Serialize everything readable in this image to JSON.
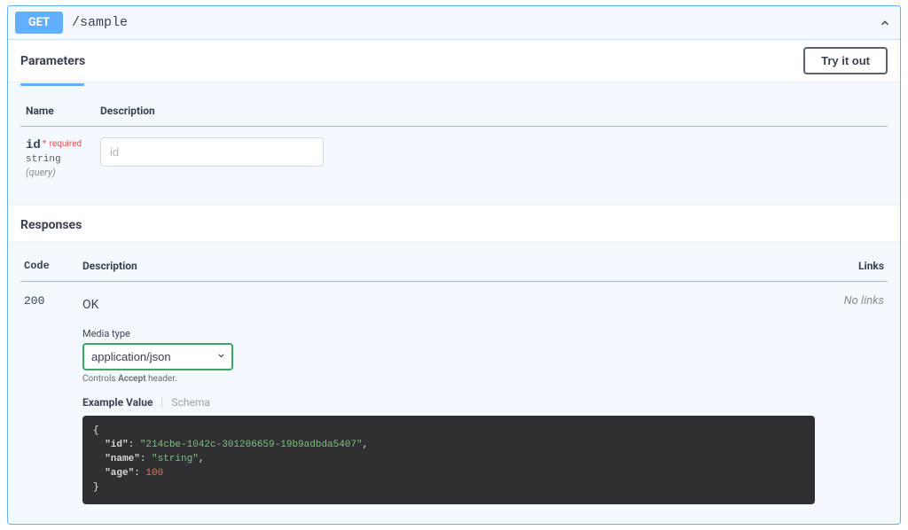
{
  "operation": {
    "method": "GET",
    "path": "/sample"
  },
  "sections": {
    "parameters_title": "Parameters",
    "try_it_out": "Try it out",
    "responses_title": "Responses"
  },
  "params_headers": {
    "name": "Name",
    "description": "Description"
  },
  "parameter": {
    "name": "id",
    "required_label": "required",
    "type": "string",
    "in_label": "(query)",
    "placeholder": "id"
  },
  "responses_headers": {
    "code": "Code",
    "description": "Description",
    "links": "Links"
  },
  "response": {
    "code": "200",
    "description": "OK",
    "no_links": "No links",
    "media_type_label": "Media type",
    "media_type_value": "application/json",
    "accept_note_prefix": "Controls ",
    "accept_note_code": "Accept",
    "accept_note_suffix": " header."
  },
  "model_tabs": {
    "example": "Example Value",
    "schema": "Schema"
  },
  "example_json": {
    "id": "214cbe-1042c-301206659-19b9adbda5407",
    "name": "string",
    "age": 100
  }
}
